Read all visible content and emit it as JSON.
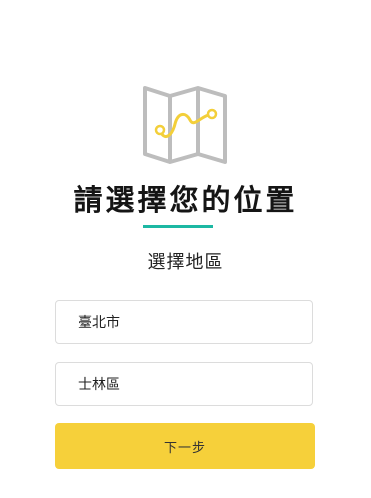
{
  "icon": "folded-map-icon",
  "header": {
    "title": "請選擇您的位置",
    "subtitle": "選擇地區"
  },
  "form": {
    "city_value": "臺北市",
    "district_value": "士林區",
    "next_label": "下一步"
  },
  "colors": {
    "accent_underline": "#1db8a3",
    "button_background": "#f6d03a",
    "map_stroke": "#bdbdbd",
    "route_color": "#f3cf3a"
  }
}
